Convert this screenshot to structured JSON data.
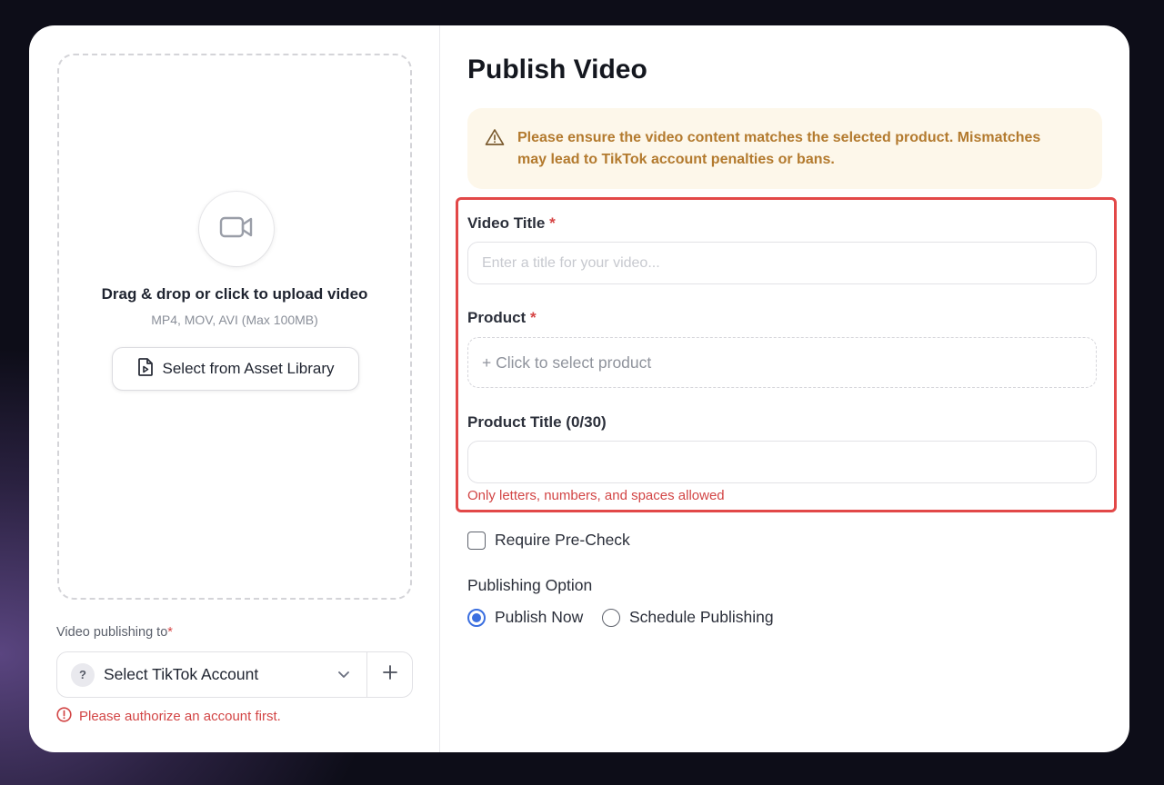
{
  "upload": {
    "icon": "video-camera-icon",
    "title": "Drag & drop or click to upload video",
    "formats": "MP4, MOV, AVI (Max 100MB)",
    "asset_library_button": "Select from Asset Library"
  },
  "account": {
    "label": "Video publishing to",
    "required_mark": "*",
    "badge": "?",
    "placeholder": "Select TikTok Account",
    "error": "Please authorize an account first."
  },
  "form": {
    "title": "Publish Video",
    "warning": "Please ensure the video content matches the selected product. Mismatches may lead to TikTok account penalties or bans.",
    "video_title_label": "Video Title",
    "video_title_placeholder": "Enter a title for your video...",
    "video_title_value": "",
    "product_label": "Product",
    "product_placeholder": "+ Click to select product",
    "product_title_label": "Product Title (0/30)",
    "product_title_value": "",
    "product_title_hint": "Only letters, numbers, and spaces allowed",
    "required_mark": "*",
    "pre_check_label": "Require Pre-Check",
    "pre_check_checked": false,
    "publishing_option_label": "Publishing Option",
    "publish_now_label": "Publish Now",
    "schedule_label": "Schedule Publishing",
    "selected_option": "Publish Now"
  },
  "colors": {
    "accent": "#3b6fe0",
    "error": "#d24545",
    "warning_bg": "#fdf7ea",
    "warning_text": "#b37a2e",
    "highlight_border": "#e24848"
  }
}
